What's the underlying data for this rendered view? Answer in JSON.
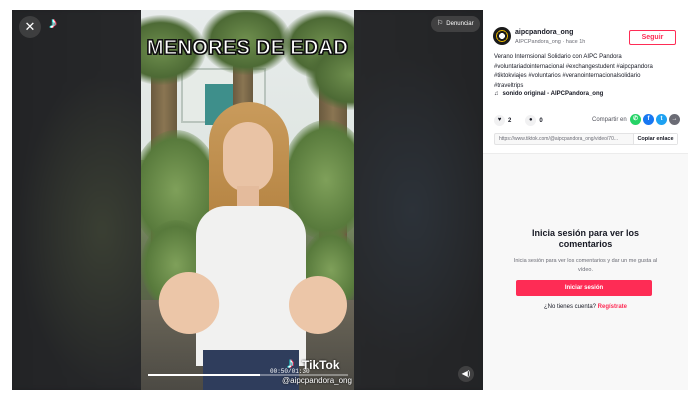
{
  "video": {
    "caption": "MENORES DE EDAD",
    "watermark_brand": "TikTok",
    "watermark_handle": "@aipcpandora_ong",
    "time": "00:50/01:30",
    "progress": 0.56,
    "report_label": "Denunciar"
  },
  "author": {
    "username": "aipcpandora_ong",
    "display_name": "AIPCPandora_ong",
    "time_ago": "hace 1h",
    "meta_separator": " · ",
    "follow_label": "Seguir"
  },
  "post": {
    "description_line1": "Verano Internsional Solidario con AIPC Pandora",
    "description_line2": "#voluntariadointernacional #exchangestudent #aipcpandora",
    "description_line3": "#tiktokviajes #voluntarios #veranointernacionalsolidario",
    "description_line4": "#traveltrips",
    "sound": "sonido original - AIPCPandora_ong",
    "likes": "2",
    "comments": "0",
    "share_label": "Compartir en",
    "link": "https://www.tiktok.com/@aipcpandora_ong/video/70...",
    "copy_label": "Copiar enlace"
  },
  "comments_panel": {
    "title": "Inicia sesión para ver los comentarios",
    "subtitle": "Inicia sesión para ver los comentarios y dar un me gusta al vídeo.",
    "login_button": "Iniciar sesión",
    "no_account": "¿No tienes cuenta?",
    "signup_link": "Regístrate"
  },
  "colors": {
    "accent": "#fe2c55",
    "whatsapp": "#25d366",
    "facebook": "#1877f2",
    "twitter": "#1da1f2",
    "more": "#6b6c75"
  },
  "icons": [
    "close-icon",
    "tiktok-logo-icon",
    "flag-icon",
    "volume-icon",
    "music-note-icon",
    "heart-icon",
    "comment-icon",
    "whatsapp-icon",
    "facebook-icon",
    "twitter-icon",
    "more-share-icon"
  ]
}
